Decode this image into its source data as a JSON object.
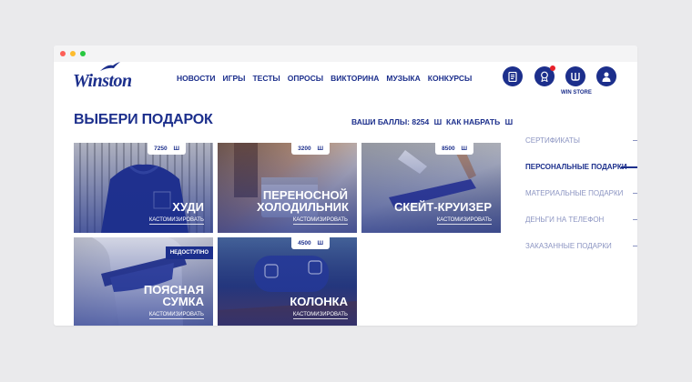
{
  "brand": {
    "logo_text": "Winston",
    "primary_color": "#1c2f8c",
    "accent_red": "#e8202a"
  },
  "nav": {
    "items": [
      "НОВОСТИ",
      "ИГРЫ",
      "ТЕСТЫ",
      "ОПРОСЫ",
      "ВИКТОРИНА",
      "МУЗЫКА",
      "КОНКУРСЫ"
    ]
  },
  "header_icons": [
    {
      "name": "document-icon",
      "label": ""
    },
    {
      "name": "award-icon",
      "label": "",
      "notification": true
    },
    {
      "name": "win-store-icon",
      "label": "WIN STORE"
    },
    {
      "name": "profile-icon",
      "label": ""
    }
  ],
  "page": {
    "title": "ВЫБЕРИ ПОДАРОК",
    "points_label": "ВАШИ БАЛЛЫ: 8254",
    "currency_symbol": "Ш",
    "how_to_earn": "КАК НАБРАТЬ"
  },
  "gifts": [
    {
      "title": "ХУДИ",
      "price": "7250",
      "action": "КАСТОМИЗИРОВАТЬ",
      "available": true
    },
    {
      "title": "ПЕРЕНОСНОЙ ХОЛОДИЛЬНИК",
      "price": "3200",
      "action": "КАСТОМИЗИРОВАТЬ",
      "available": true
    },
    {
      "title": "СКЕЙТ-КРУИЗЕР",
      "price": "8500",
      "action": "КАСТОМИЗИРОВАТЬ",
      "available": true
    },
    {
      "title": "ПОЯСНАЯ СУМКА",
      "price": "",
      "action": "КАСТОМИЗИРОВАТЬ",
      "available": false,
      "status": "НЕДОСТУПНО"
    },
    {
      "title": "КОЛОНКА",
      "price": "4500",
      "action": "КАСТОМИЗИРОВАТЬ",
      "available": true
    }
  ],
  "sidebar": {
    "items": [
      "СЕРТИФИКАТЫ",
      "ПЕРСОНАЛЬНЫЕ ПОДАРКИ",
      "МАТЕРИАЛЬНЫЕ ПОДАРКИ",
      "ДЕНЬГИ НА ТЕЛЕФОН",
      "ЗАКАЗАННЫЕ ПОДАРКИ"
    ],
    "active_index": 1
  }
}
